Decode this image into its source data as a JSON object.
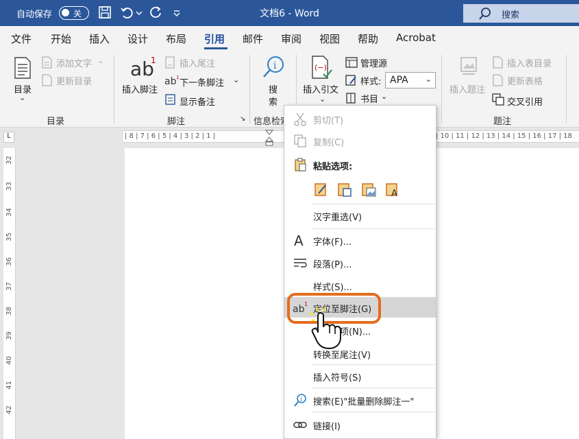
{
  "titlebar": {
    "autosave_label": "自动保存",
    "toggle_state": "关",
    "doc_title": "文档6  -  Word",
    "search_label": "搜索"
  },
  "menu": {
    "tabs": [
      "文件",
      "开始",
      "插入",
      "设计",
      "布局",
      "引用",
      "邮件",
      "审阅",
      "视图",
      "帮助",
      "Acrobat"
    ],
    "active": "引用"
  },
  "ribbon": {
    "toc": {
      "main": "目录",
      "add_text": "添加文字",
      "update": "更新目录",
      "group": "目录"
    },
    "footnote": {
      "insert": "插入脚注",
      "insert_endnote": "插入尾注",
      "next": "下一条脚注",
      "show_notes": "显示备注",
      "group": "脚注"
    },
    "research": {
      "search": "搜索",
      "group": "信息检索"
    },
    "citation": {
      "insert": "插入引文",
      "manage": "管理源",
      "style_label": "样式:",
      "style_value": "APA",
      "bib": "书目"
    },
    "captions": {
      "insert": "插入题注",
      "insert_table_fig": "插入表目录",
      "update_table": "更新表格",
      "cross_ref": "交叉引用",
      "group": "题注"
    }
  },
  "ruler": {
    "left_marks": "| 8 | 7 | 6 | 5 | 4 | 3 | 2 | 1 |",
    "right_marks": "| 10 | 11 | 12 | 13 | 14 | 15 | 16 | 17 | 18",
    "vertical": [
      "32",
      "33",
      "34",
      "35",
      "36",
      "37",
      "38",
      "39",
      "40",
      "41",
      "42"
    ]
  },
  "context_menu": {
    "cut": "剪切(T)",
    "copy": "复制(C)",
    "paste_options": "粘贴选项:",
    "reconvert": "汉字重选(V)",
    "font": "字体(F)...",
    "paragraph": "段落(P)...",
    "style": "样式(S)...",
    "goto_footnote": "定位至脚注(G)",
    "note_options": "便笺选项(N)...",
    "convert_endnote": "转换至尾注(V)",
    "insert_symbol": "插入符号(S)",
    "search": "搜索(E)\"批量删除脚注一\"",
    "link": "链接(I)"
  },
  "colors": {
    "brand": "#2b579a",
    "highlight": "#e36c1e"
  }
}
